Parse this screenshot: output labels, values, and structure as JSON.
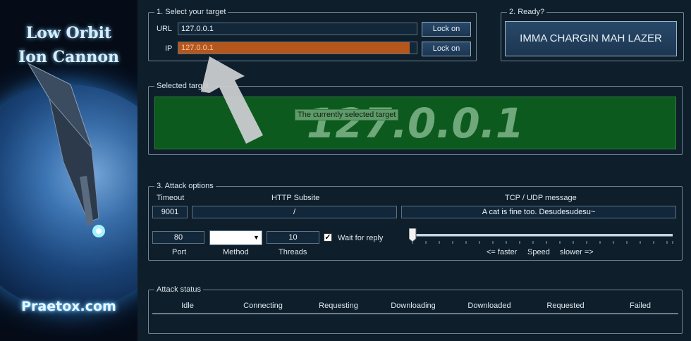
{
  "banner": {
    "title_line1": "Low Orbit",
    "title_line2": "Ion Cannon",
    "site": "Praetox.com"
  },
  "target": {
    "legend": "1. Select your target",
    "url_label": "URL",
    "url_value": "127.0.0.1",
    "url_button": "Lock on",
    "ip_label": "IP",
    "ip_value": "127.0.0.1",
    "ip_button": "Lock on"
  },
  "ready": {
    "legend": "2. Ready?",
    "fire_button": "IMMA CHARGIN MAH LAZER"
  },
  "selected": {
    "legend": "Selected target",
    "value": "127.0.0.1",
    "tooltip": "The currently selected target"
  },
  "attack_options": {
    "legend": "3. Attack options",
    "timeout_label": "Timeout",
    "timeout_value": "9001",
    "subsite_label": "HTTP Subsite",
    "subsite_value": "/",
    "message_label": "TCP / UDP message",
    "message_value": "A cat is fine too. Desudesudesu~",
    "port_value": "80",
    "port_label": "Port",
    "method_value": "",
    "method_label": "Method",
    "threads_value": "10",
    "threads_label": "Threads",
    "wait_label": "Wait for reply",
    "wait_checked": true,
    "speed_faster": "<= faster",
    "speed_label": "Speed",
    "speed_slower": "slower =>",
    "speed_level": 0
  },
  "attack_status": {
    "legend": "Attack status",
    "columns": [
      "Idle",
      "Connecting",
      "Requesting",
      "Downloading",
      "Downloaded",
      "Requested",
      "Failed"
    ]
  },
  "colors": {
    "background": "#0e1e2b",
    "target_panel": "#0d5a1e",
    "ip_field_highlight": "#b5571d"
  }
}
